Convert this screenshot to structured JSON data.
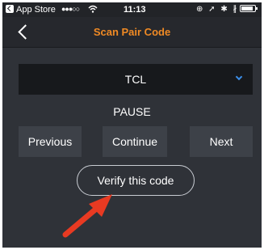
{
  "status_bar": {
    "carrier": "App Store",
    "signal": "●●●○○",
    "wifi_icon": "wifi-icon",
    "time": "11:13",
    "icons": "⊕ ➚ ✱ ∦",
    "back_icon": "back-to-app-icon",
    "battery_icon": "battery-icon"
  },
  "nav": {
    "back_icon": "chevron-left-icon",
    "title": "Scan Pair Code",
    "title_color": "#f08a24"
  },
  "brand_select": {
    "selected_value": "TCL",
    "icon": "chevron-down-icon",
    "icon_color": "#3b8ee8"
  },
  "code_label": "PAUSE",
  "buttons": {
    "previous": "Previous",
    "continue": "Continue",
    "next": "Next",
    "verify": "Verify this code"
  },
  "annotation": {
    "icon": "red-arrow-icon",
    "color": "#e83a22"
  }
}
